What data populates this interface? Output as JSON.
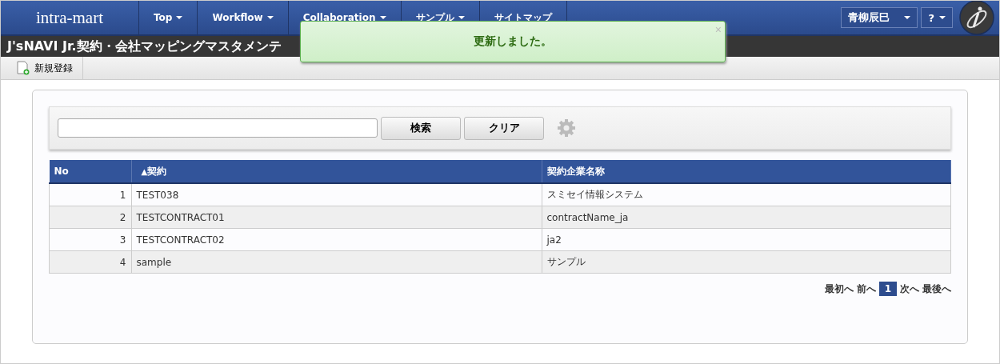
{
  "header": {
    "logo": "intra-mart",
    "menu": [
      {
        "label": "Top",
        "caret": true
      },
      {
        "label": "Workflow",
        "caret": true
      },
      {
        "label": "Collaboration",
        "caret": true
      },
      {
        "label": "サンプル",
        "caret": true
      },
      {
        "label": "サイトマップ",
        "caret": false
      }
    ],
    "user": "青柳辰巳",
    "help": "?"
  },
  "page_title": "J'sNAVI Jr.契約・会社マッピングマスタメンテ",
  "toolbar": {
    "new_button": "新規登録"
  },
  "toast": {
    "message": "更新しました。",
    "close": "×"
  },
  "search": {
    "buttons": [
      "検索",
      "クリア"
    ]
  },
  "table": {
    "columns": [
      {
        "label": "No"
      },
      {
        "label": "契約",
        "sort_mark": "▲"
      },
      {
        "label": "契約企業名称"
      }
    ],
    "rows": [
      {
        "no": "1",
        "contract": "TEST038",
        "company": "スミセイ情報システム"
      },
      {
        "no": "2",
        "contract": "TESTCONTRACT01",
        "company": "contractName_ja"
      },
      {
        "no": "3",
        "contract": "TESTCONTRACT02",
        "company": "ja2"
      },
      {
        "no": "4",
        "contract": "sample",
        "company": "サンプル"
      }
    ]
  },
  "pager": {
    "first": "最初へ",
    "prev": "前へ",
    "pages": [
      {
        "label": "1",
        "selected": true
      }
    ],
    "next": "次へ",
    "last": "最後へ"
  }
}
